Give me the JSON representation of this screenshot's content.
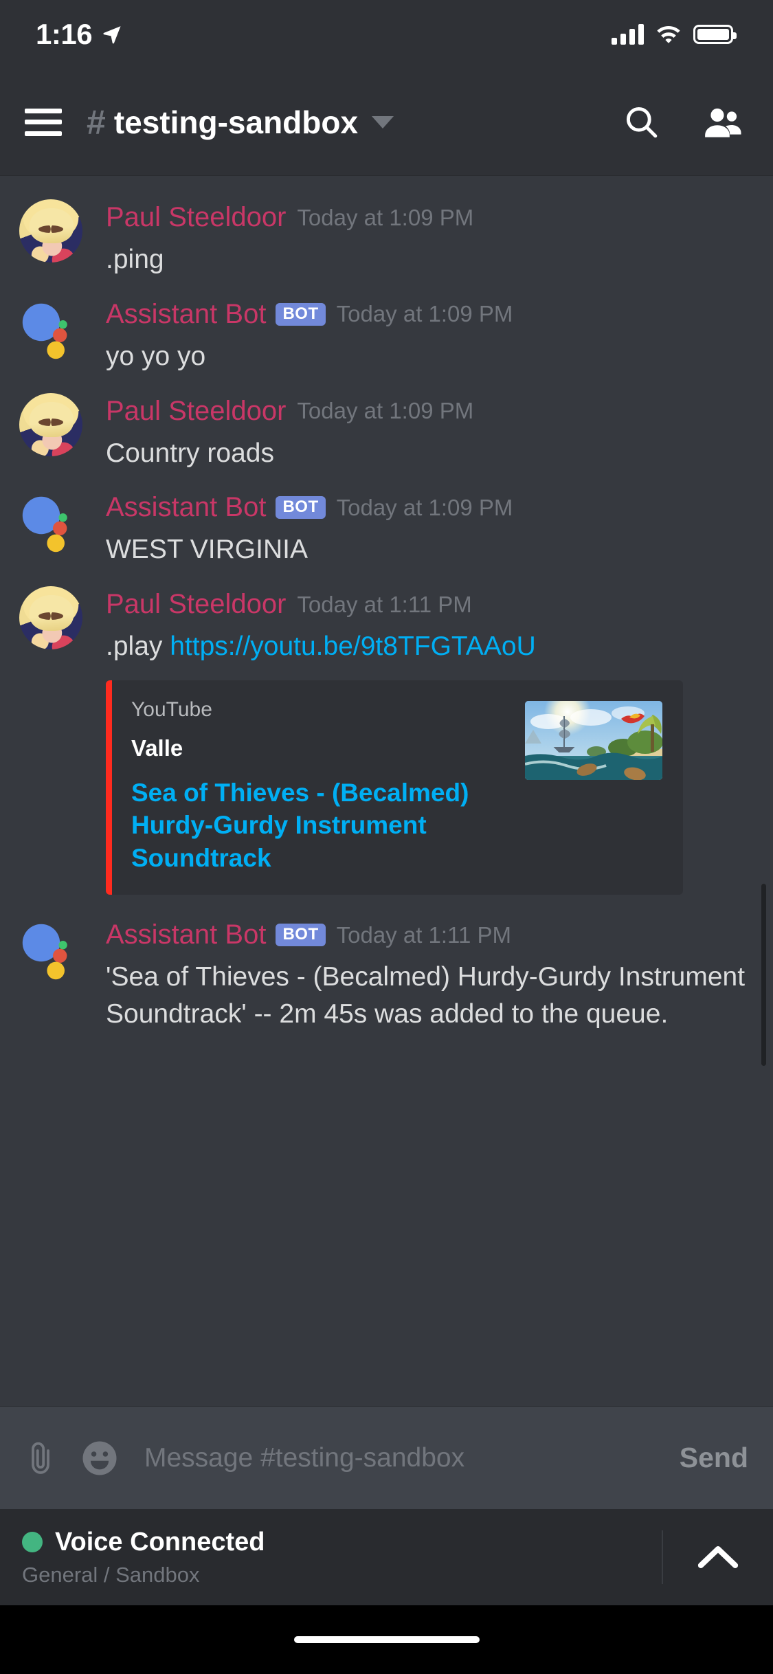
{
  "status_bar": {
    "time": "1:16",
    "location_icon": "location-arrow-icon",
    "signal_icon": "cellular-signal-icon",
    "wifi_icon": "wifi-icon",
    "battery_icon": "battery-icon"
  },
  "header": {
    "menu_icon": "hamburger-menu-icon",
    "hash": "#",
    "channel_name": "testing-sandbox",
    "dropdown_icon": "chevron-down-icon",
    "search_icon": "search-icon",
    "members_icon": "members-icon"
  },
  "messages": [
    {
      "author": "Paul Steeldoor",
      "is_bot": false,
      "bot_tag": "",
      "timestamp": "Today at 1:09 PM",
      "text": ".ping",
      "avatar": "anime-avatar"
    },
    {
      "author": "Assistant Bot",
      "is_bot": true,
      "bot_tag": "BOT",
      "timestamp": "Today at 1:09 PM",
      "text": "yo yo yo",
      "avatar": "assistant-bot-avatar"
    },
    {
      "author": "Paul Steeldoor",
      "is_bot": false,
      "bot_tag": "",
      "timestamp": "Today at 1:09 PM",
      "text": "Country roads",
      "avatar": "anime-avatar"
    },
    {
      "author": "Assistant Bot",
      "is_bot": true,
      "bot_tag": "BOT",
      "timestamp": "Today at 1:09 PM",
      "text": "WEST VIRGINIA",
      "avatar": "assistant-bot-avatar"
    },
    {
      "author": "Paul Steeldoor",
      "is_bot": false,
      "bot_tag": "",
      "timestamp": "Today at 1:11 PM",
      "text_prefix": ".play ",
      "link": "https://youtu.be/9t8TFGTAAoU",
      "avatar": "anime-avatar",
      "embed": {
        "provider": "YouTube",
        "author": "Valle",
        "title": "Sea of Thieves - (Becalmed) Hurdy-Gurdy Instrument Soundtrack",
        "accent_color": "#ff2b1f",
        "thumbnail": "sea-of-thieves-thumbnail"
      }
    },
    {
      "author": "Assistant Bot",
      "is_bot": true,
      "bot_tag": "BOT",
      "timestamp": "Today at 1:11 PM",
      "text": "'Sea of Thieves - (Becalmed)  Hurdy-Gurdy Instrument Soundtrack' -- 2m 45s was added to the queue.",
      "avatar": "assistant-bot-avatar"
    }
  ],
  "composer": {
    "attach_icon": "paperclip-icon",
    "emoji_icon": "emoji-icon",
    "placeholder": "Message #testing-sandbox",
    "send_label": "Send"
  },
  "voice": {
    "status": "Voice Connected",
    "channel_path": "General / Sandbox",
    "status_color": "#43b581",
    "expand_icon": "chevron-up-icon"
  },
  "colors": {
    "app_background": "#36393f",
    "header_background": "#2f3136",
    "username": "#c93767",
    "link": "#00aff4",
    "bot_tag": "#7289da",
    "text": "#dcddde",
    "muted": "#72767d"
  }
}
